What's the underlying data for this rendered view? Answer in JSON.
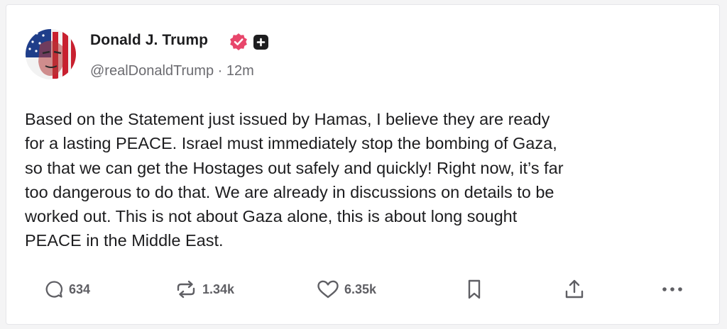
{
  "post": {
    "author": {
      "display_name": "Donald J. Trump",
      "handle": "@realDonaldTrump",
      "separator": "·",
      "time_ago": "12m",
      "verified_icon": "verified-badge-icon",
      "plus_icon": "plus-badge-icon",
      "verified_color": "#e8466b"
    },
    "text_lines": [
      "Based on the Statement just issued by Hamas, I believe they are ready",
      "for a lasting PEACE. Israel must immediately stop the bombing of Gaza,",
      "so that we can get the Hostages out safely and quickly! Right now, it’s far",
      "too dangerous to do that. We are already in discussions on details to be",
      "worked out. This is not about Gaza alone, this is about long sought",
      "PEACE in the Middle East."
    ],
    "actions": {
      "reply": {
        "icon": "reply-icon",
        "count": "634"
      },
      "repost": {
        "icon": "repost-icon",
        "count": "1.34k"
      },
      "like": {
        "icon": "heart-icon",
        "count": "6.35k"
      },
      "bookmark": {
        "icon": "bookmark-icon"
      },
      "share": {
        "icon": "share-icon"
      },
      "more": {
        "icon": "more-icon"
      }
    }
  }
}
